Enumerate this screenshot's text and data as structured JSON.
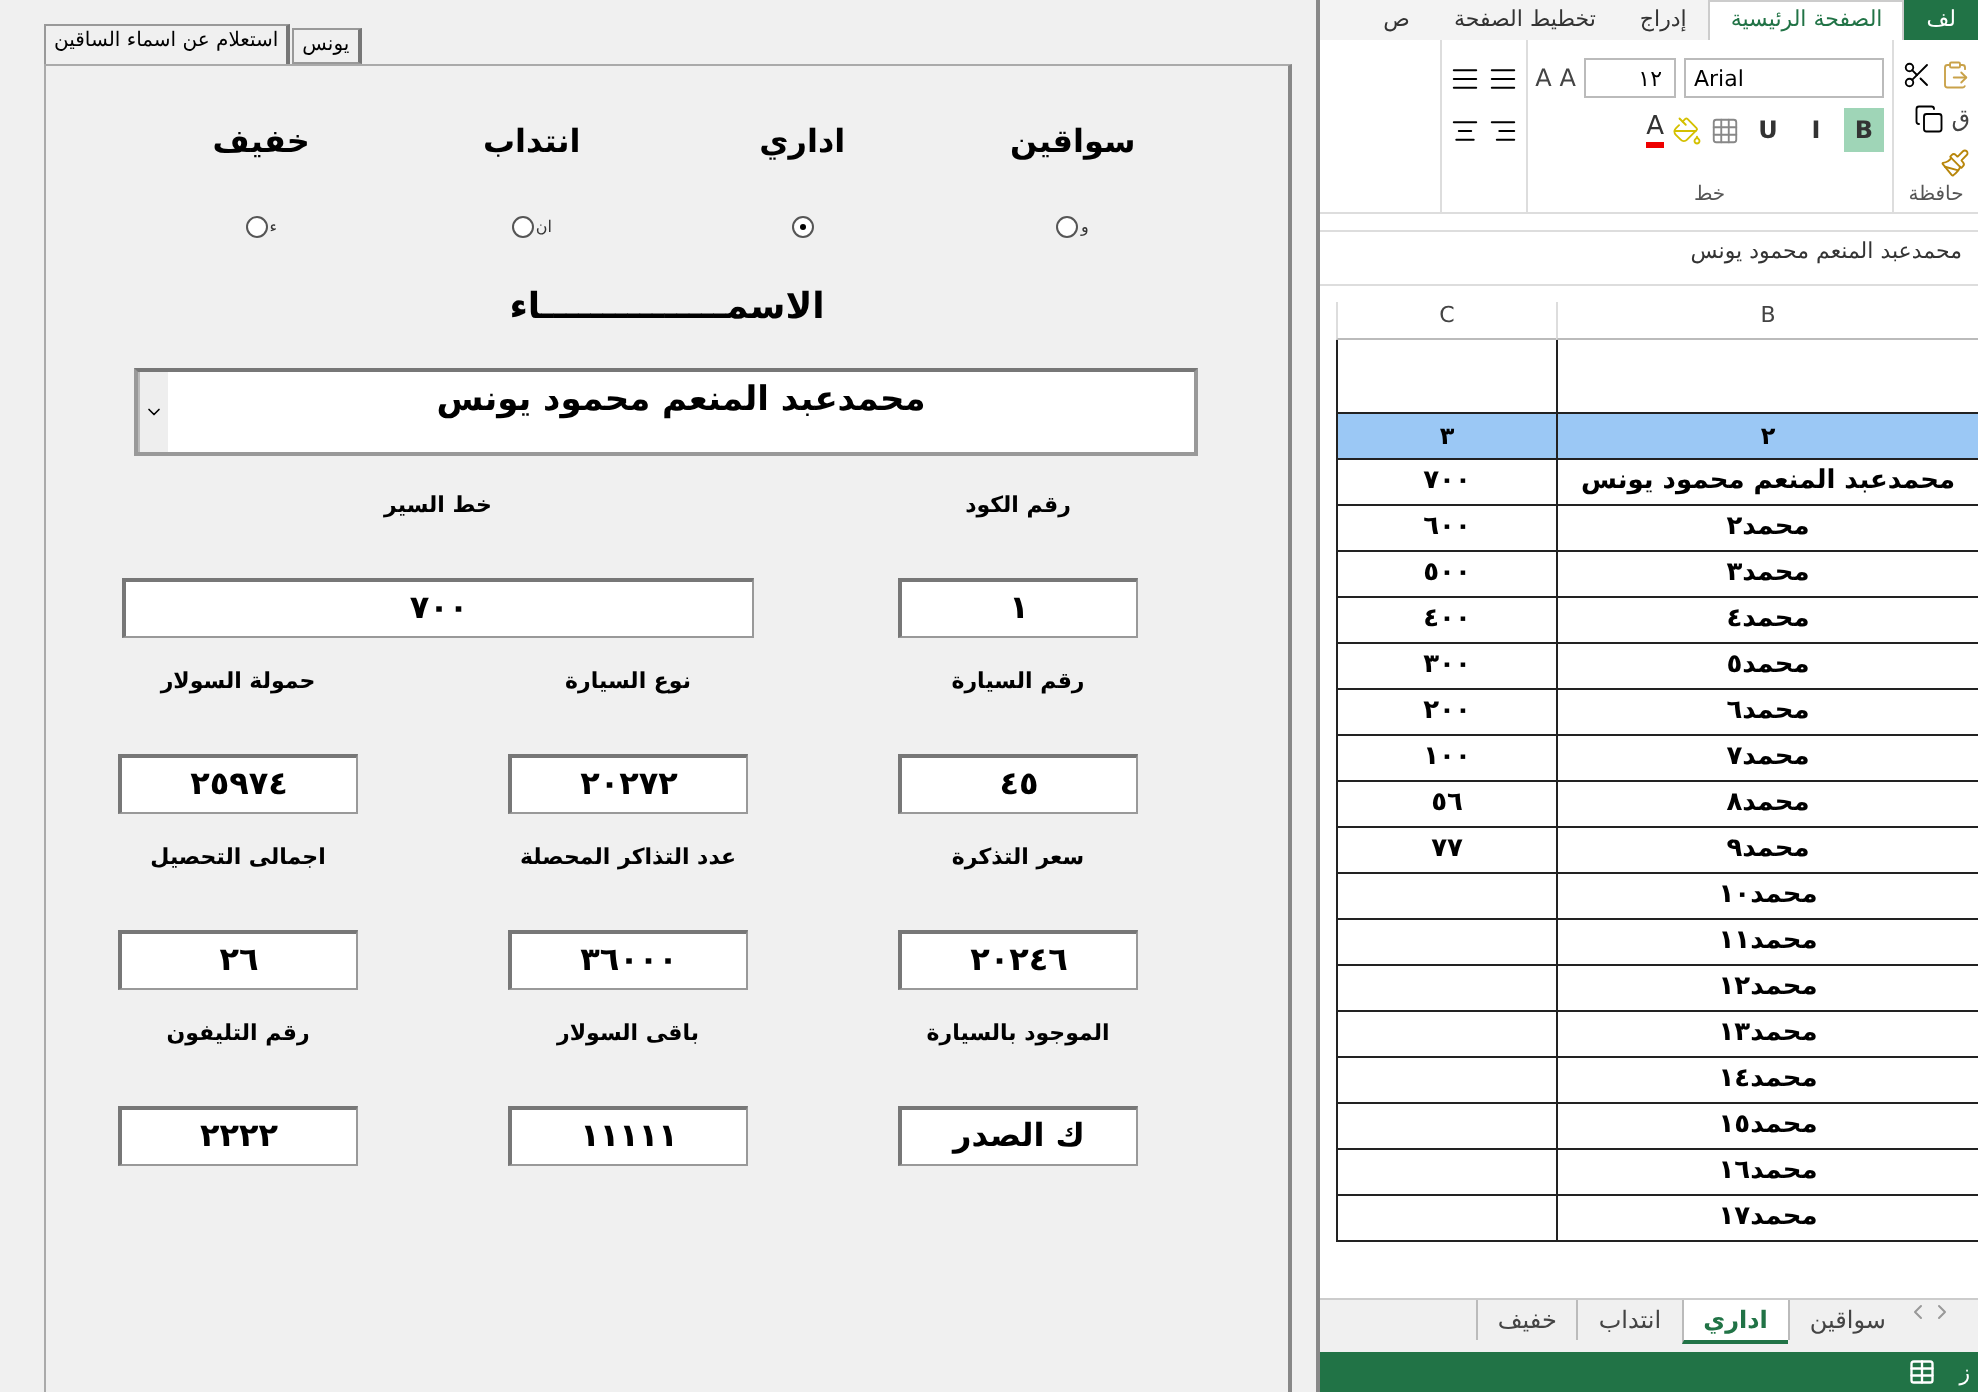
{
  "form": {
    "tabs": [
      {
        "label": "يونس",
        "selected": false
      },
      {
        "label": "استعلام عن اسماء الساقين",
        "selected": true
      }
    ],
    "options": [
      {
        "label": "سواقين",
        "caption": "و",
        "selected": false
      },
      {
        "label": "اداري",
        "selected": true
      },
      {
        "label": "انتداب",
        "caption": "ان",
        "selected": false
      },
      {
        "label": "خفيف",
        "caption": "ء",
        "selected": false
      }
    ],
    "names_heading": "الاسمـــــــــــــــاء",
    "name_combo": {
      "value": "محمدعبد المنعم محمود يونس"
    },
    "field_rows": [
      [
        {
          "label": "رقم الكود",
          "value": "١"
        },
        {
          "label": "خط السير",
          "value": "٧٠٠",
          "kind": "wide"
        }
      ],
      [
        {
          "label": "رقم السيارة",
          "value": "٤٥"
        },
        {
          "label": "نوع السيارة",
          "value": "٢٠٢٧٢"
        },
        {
          "label": "حمولة السولار",
          "value": "٢٥٩٧٤"
        }
      ],
      [
        {
          "label": "سعر التذكرة",
          "value": "٢٠٢٤٦"
        },
        {
          "label": "عدد التذاكر المحصلة",
          "value": "٣٦٠٠٠"
        },
        {
          "label": "اجمالى التحصيل",
          "value": "٢٦"
        }
      ],
      [
        {
          "label": "الموجود بالسيارة",
          "value": "ك الصدر"
        },
        {
          "label": "باقى السولار",
          "value": "١١١١١"
        },
        {
          "label": "رقم التليفون",
          "value": "٢٢٢٢"
        }
      ]
    ]
  },
  "excel": {
    "ribbon_tabs": [
      {
        "label": "لف",
        "kind": "file",
        "selected": false
      },
      {
        "label": "الصفحة الرئيسية",
        "selected": true
      },
      {
        "label": "إدراج",
        "selected": false
      },
      {
        "label": "تخطيط الصفحة",
        "selected": false
      },
      {
        "label": "ص",
        "selected": false
      }
    ],
    "font_name": "Arial",
    "font_size": "١٢",
    "grow_labels": [
      "A",
      "A"
    ],
    "style_buttons": [
      {
        "label": "B",
        "on": true
      },
      {
        "label": "I",
        "on": false
      },
      {
        "label": "U",
        "on": false
      }
    ],
    "font_color_label": "A",
    "paste_label": "ق",
    "groups": [
      "حافظة",
      "خط"
    ],
    "formula": "محمدعبد المنعم محمود يونس",
    "columns": [
      "B",
      "C"
    ],
    "rows": [
      {
        "kind": "blank",
        "cells": [
          "",
          ""
        ]
      },
      {
        "kind": "header",
        "cells": [
          "٢",
          "٣"
        ]
      },
      {
        "kind": "data",
        "cells": [
          "محمدعبد المنعم محمود يونس",
          "٧٠٠"
        ]
      },
      {
        "kind": "data",
        "cells": [
          "محمد٢",
          "٦٠٠"
        ]
      },
      {
        "kind": "data",
        "cells": [
          "محمد٣",
          "٥٠٠"
        ]
      },
      {
        "kind": "data",
        "cells": [
          "محمد٤",
          "٤٠٠"
        ]
      },
      {
        "kind": "data",
        "cells": [
          "محمد٥",
          "٣٠٠"
        ]
      },
      {
        "kind": "data",
        "cells": [
          "محمد٦",
          "٢٠٠"
        ]
      },
      {
        "kind": "data",
        "cells": [
          "محمد٧",
          "١٠٠"
        ]
      },
      {
        "kind": "data",
        "cells": [
          "محمد٨",
          "٥٦"
        ]
      },
      {
        "kind": "data",
        "cells": [
          "محمد٩",
          "٧٧"
        ]
      },
      {
        "kind": "data",
        "cells": [
          "محمد١٠",
          ""
        ]
      },
      {
        "kind": "data",
        "cells": [
          "محمد١١",
          ""
        ]
      },
      {
        "kind": "data",
        "cells": [
          "محمد١٢",
          ""
        ]
      },
      {
        "kind": "data",
        "cells": [
          "محمد١٣",
          ""
        ]
      },
      {
        "kind": "data",
        "cells": [
          "محمد١٤",
          ""
        ]
      },
      {
        "kind": "data",
        "cells": [
          "محمد١٥",
          ""
        ]
      },
      {
        "kind": "data",
        "cells": [
          "محمد١٦",
          ""
        ]
      },
      {
        "kind": "data",
        "cells": [
          "محمد١٧",
          ""
        ]
      }
    ],
    "sheets": [
      {
        "label": "سواقين",
        "selected": false
      },
      {
        "label": "اداري",
        "selected": true
      },
      {
        "label": "انتداب",
        "selected": false
      },
      {
        "label": "خفيف",
        "selected": false
      }
    ],
    "status": "ز"
  }
}
